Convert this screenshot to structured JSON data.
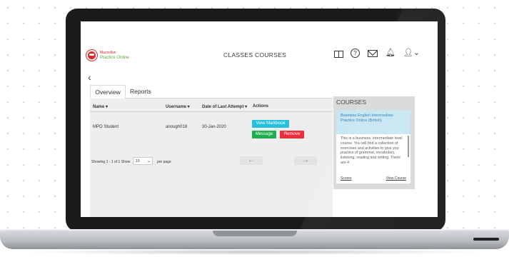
{
  "app": {
    "logo_line1": "Macmillan",
    "logo_line2": "Practice Online"
  },
  "nav": {
    "classes": "CLASSES",
    "courses": "COURSES"
  },
  "header_icons": [
    "book-icon",
    "help-icon",
    "mail-icon",
    "bell-icon",
    "user-icon"
  ],
  "back_label": "‹",
  "tabs": [
    {
      "label": "Overview",
      "active": true
    },
    {
      "label": "Reports",
      "active": false
    }
  ],
  "table": {
    "columns": [
      "Name ▾",
      "Username ▾",
      "Date of Last Attempt ▾",
      "Actions"
    ],
    "rows": [
      {
        "name": "MPO Student",
        "username": "anough018",
        "date": "30-Jan-2020"
      }
    ],
    "actions": {
      "view_markbook": "View Markbook",
      "message": "Message",
      "remove": "Remove"
    }
  },
  "pagination": {
    "info": "Showing 1 - 1 of 1  Show",
    "show_value": "10",
    "per_page": "per page",
    "prev": "←",
    "next": "→"
  },
  "courses_panel": {
    "title": "COURSES",
    "course_name": "Business English Intermediate Practice Online (British)",
    "description": "This is a business, intermediate level course. You will find a collection of exercises and activities to give you practice of grammar, vocabulary, listening, reading and writing. There are 4",
    "scores_link": "Scores",
    "view_course_link": "View Course"
  },
  "colors": {
    "view_markbook": "#25c1dc",
    "message": "#1fae4f",
    "remove": "#ea2e3b",
    "course_header_bg": "#c9e6f3"
  }
}
